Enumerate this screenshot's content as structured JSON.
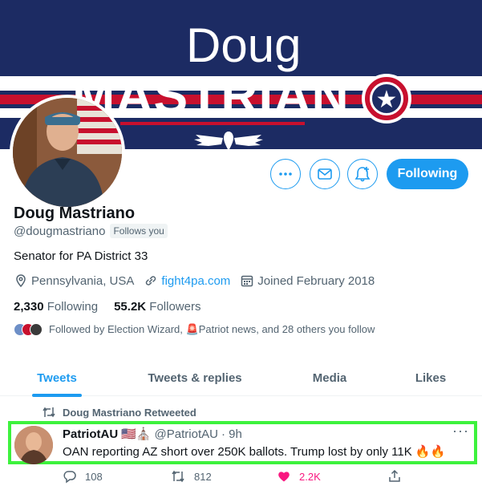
{
  "banner": {
    "line1": "Doug",
    "line2": "MASTRIAN",
    "star": "★"
  },
  "colors": {
    "accent": "#1d9bf0",
    "banner_blue": "#1c2b63",
    "banner_red": "#c8102e",
    "like": "#f91880",
    "highlight": "#3df23d"
  },
  "profile": {
    "name": "Doug Mastriano",
    "handle": "@dougmastriano",
    "follows_you": "Follows you",
    "bio": "Senator for PA District 33",
    "location": "Pennsylvania, USA",
    "website": "fight4pa.com",
    "joined": "Joined February 2018",
    "following_count": "2,330",
    "following_label": "Following",
    "followers_count": "55.2K",
    "followers_label": "Followers",
    "followed_by": "Followed by Election Wizard, 🚨Patriot news, and 28 others you follow"
  },
  "buttons": {
    "follow": "Following",
    "more_icon": "more-icon",
    "message_icon": "mail-icon",
    "notify_icon": "bell-plus-icon"
  },
  "tabs": [
    {
      "label": "Tweets",
      "active": true
    },
    {
      "label": "Tweets & replies",
      "active": false
    },
    {
      "label": "Media",
      "active": false
    },
    {
      "label": "Likes",
      "active": false
    }
  ],
  "tweet": {
    "retweeted_by": "Doug Mastriano Retweeted",
    "author_name": "PatriotAU",
    "author_emoji": "🇺🇸⛪",
    "author_handle": "@PatriotAU",
    "time": "· 9h",
    "more": "···",
    "text": "OAN reporting AZ short over 250K ballots. Trump lost by only 11K 🔥🔥",
    "replies": "108",
    "retweets": "812",
    "likes": "2.2K"
  }
}
